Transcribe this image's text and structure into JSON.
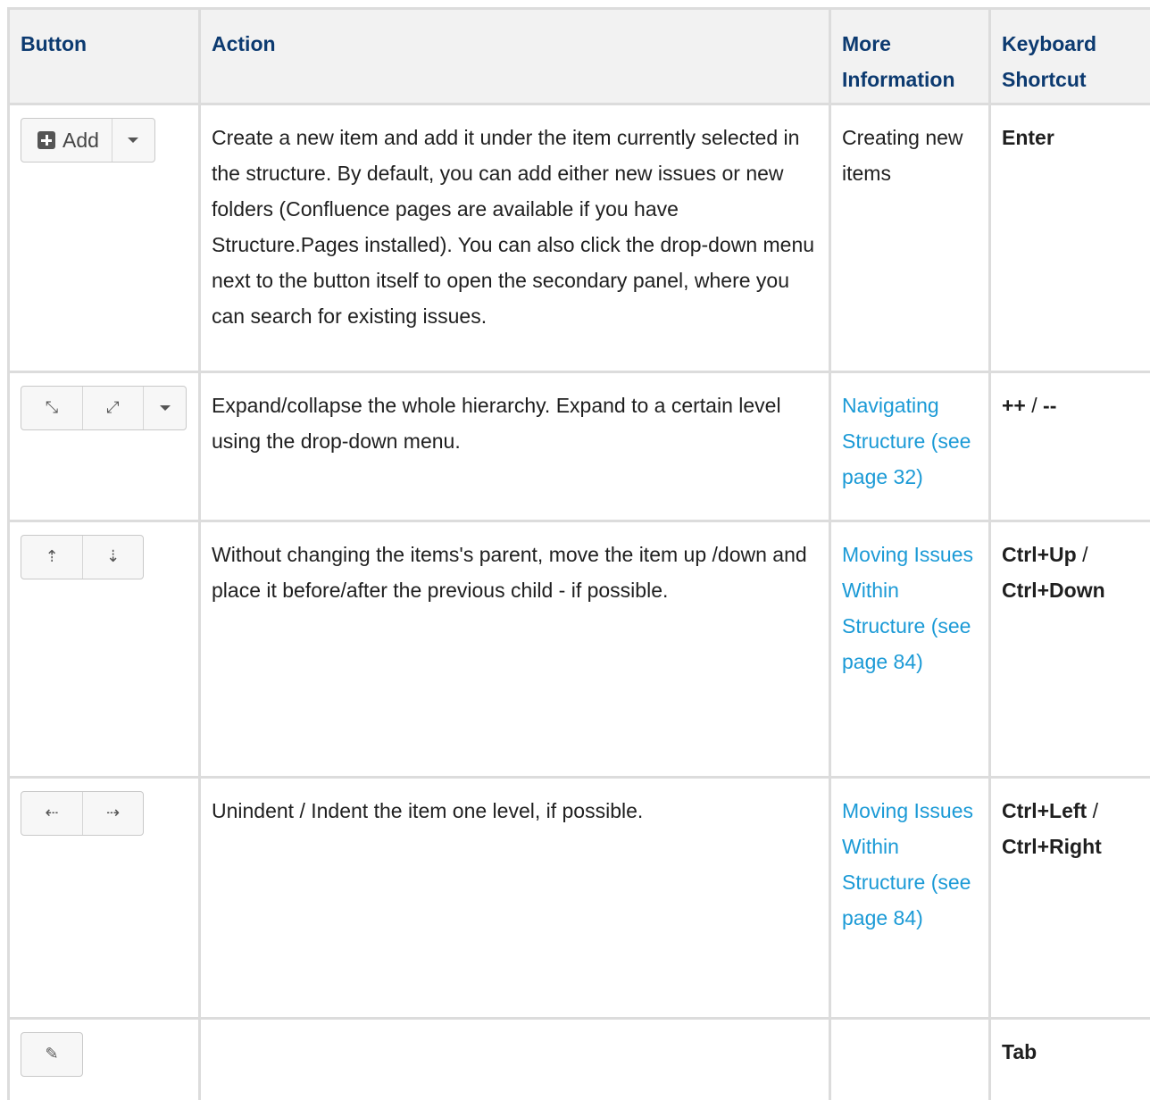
{
  "headers": {
    "button": "Button",
    "action": "Action",
    "more_info": "More Information",
    "shortcut": "Keyboard Shortcut"
  },
  "rows": [
    {
      "button": {
        "label": "Add",
        "icons": [
          "plus-square-icon",
          "chevron-down-icon"
        ]
      },
      "action": "Create a new item and add it under the item currently selected in the structure. By default, you can add either new issues or new folders (Confluence pages are available if you have Structure.Pages installed). You can also click the drop-down menu next to the button itself to open the secondary panel, where you can search for existing issues.",
      "more_info": "Creating new items",
      "more_info_is_link": false,
      "shortcut": {
        "key1": "Enter",
        "sep": "",
        "key2": ""
      }
    },
    {
      "button": {
        "icons": [
          "expand-icon",
          "collapse-icon",
          "chevron-down-icon"
        ],
        "glyphs": [
          "⤡",
          "⤢"
        ]
      },
      "action": "Expand/collapse the whole hierarchy. Expand to a certain level using the drop-down menu.",
      "more_info": "Navigating Structure (see page 32)",
      "more_info_is_link": true,
      "shortcut": {
        "key1": "++",
        "sep": " / ",
        "key2": "--"
      }
    },
    {
      "button": {
        "icons": [
          "move-up-icon",
          "move-down-icon"
        ],
        "glyphs": [
          "⇡",
          "⇣"
        ]
      },
      "action": "Without changing the items's parent, move the item up /down and place it before/after the previous child - if possible.",
      "more_info": "Moving Issues Within Structure (see page 84)",
      "more_info_is_link": true,
      "shortcut": {
        "key1": "Ctrl+Up",
        "sep": " / ",
        "key2": "Ctrl+Down"
      }
    },
    {
      "button": {
        "icons": [
          "unindent-icon",
          "indent-icon"
        ],
        "glyphs": [
          "⇠",
          "⇢"
        ]
      },
      "action": "Unindent / Indent the item one level, if possible.",
      "more_info": "Moving Issues Within Structure (see page 84)",
      "more_info_is_link": true,
      "shortcut": {
        "key1": "Ctrl+Left",
        "sep": " / ",
        "key2": "Ctrl+Right"
      }
    },
    {
      "button": {
        "icons": [
          "pencil-icon"
        ],
        "glyphs": [
          "✎"
        ]
      },
      "action": "",
      "more_info": "",
      "more_info_is_link": false,
      "shortcut": {
        "key1": "Tab",
        "sep": "",
        "key2": ""
      }
    }
  ],
  "colors": {
    "header_text": "#0c3a70",
    "link": "#1b9ad6",
    "border": "#dcdcdc",
    "header_bg": "#f2f2f2"
  }
}
